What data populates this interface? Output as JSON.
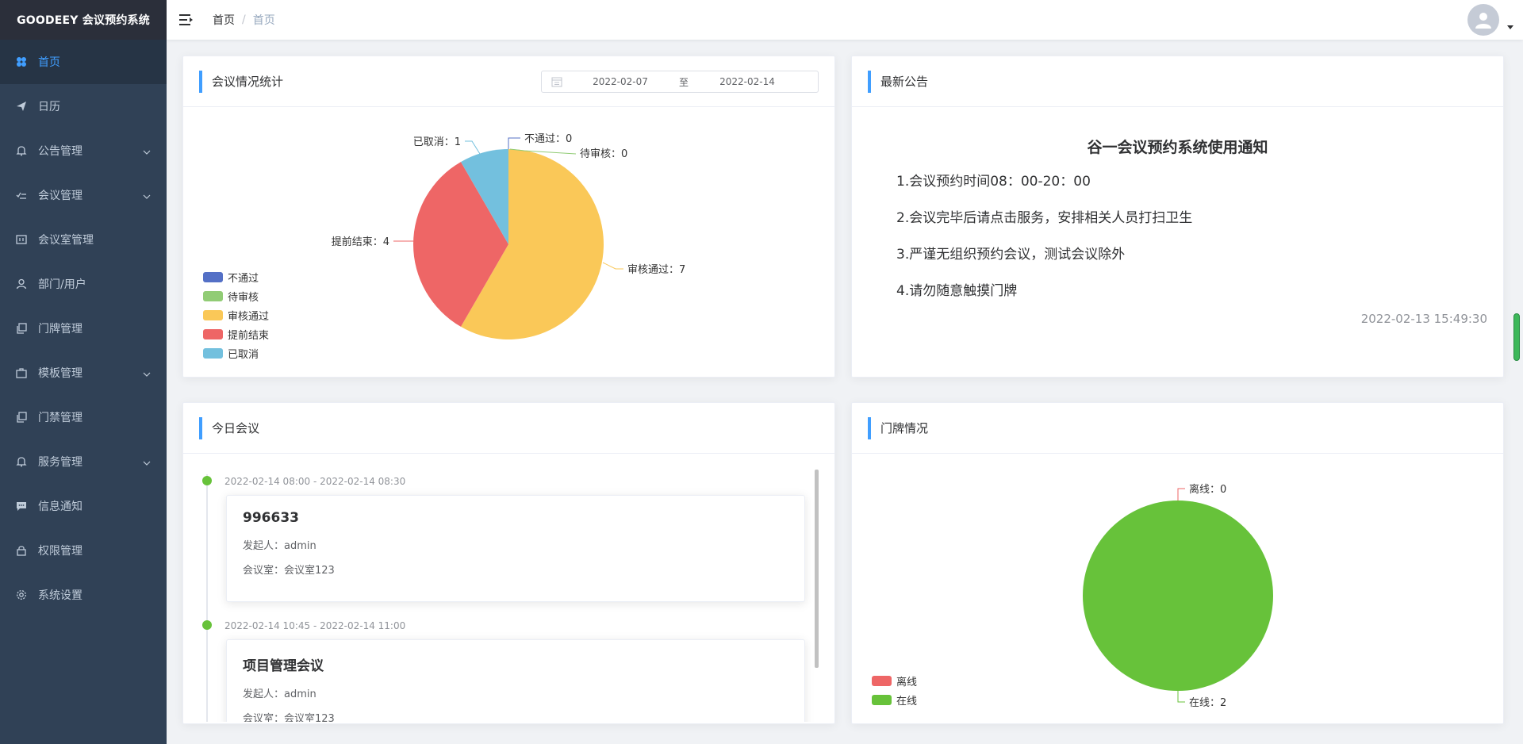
{
  "app": {
    "title": "GOODEEY 会议预约系统"
  },
  "sidebar": {
    "items": [
      {
        "label": "首页",
        "icon": "dashboard-icon",
        "active": true
      },
      {
        "label": "日历",
        "icon": "send-icon"
      },
      {
        "label": "公告管理",
        "icon": "bell-icon",
        "expandable": true
      },
      {
        "label": "会议管理",
        "icon": "check-list-icon",
        "expandable": true
      },
      {
        "label": "会议室管理",
        "icon": "room-icon"
      },
      {
        "label": "部门/用户",
        "icon": "user-icon"
      },
      {
        "label": "门牌管理",
        "icon": "copy-icon"
      },
      {
        "label": "模板管理",
        "icon": "briefcase-icon",
        "expandable": true
      },
      {
        "label": "门禁管理",
        "icon": "copy-icon"
      },
      {
        "label": "服务管理",
        "icon": "bell-icon",
        "expandable": true
      },
      {
        "label": "信息通知",
        "icon": "message-icon"
      },
      {
        "label": "权限管理",
        "icon": "lock-icon"
      },
      {
        "label": "系统设置",
        "icon": "gear-icon"
      }
    ]
  },
  "header": {
    "breadcrumb": [
      "首页",
      "首页"
    ],
    "separator": "/"
  },
  "stats": {
    "title": "会议情况统计",
    "date_start": "2022-02-07",
    "date_sep": "至",
    "date_end": "2022-02-14"
  },
  "notice": {
    "title": "最新公告",
    "heading": "谷一会议预约系统使用通知",
    "lines": [
      "1.会议预约时间08：00-20：00",
      "2.会议完毕后请点击服务，安排相关人员打扫卫生",
      "3.严谨无组织预约会议，测试会议除外",
      "4.请勿随意触摸门牌"
    ],
    "time": "2022-02-13 15:49:30"
  },
  "today": {
    "title": "今日会议",
    "meetings": [
      {
        "time": "2022-02-14 08:00 - 2022-02-14 08:30",
        "name": "996633",
        "initiator": "发起人：admin",
        "room": "会议室：会议室123"
      },
      {
        "time": "2022-02-14 10:45 - 2022-02-14 11:00",
        "name": "项目管理会议",
        "initiator": "发起人：admin",
        "room": "会议室：会议室123"
      }
    ]
  },
  "doorplate": {
    "title": "门牌情况"
  },
  "chart_data": [
    {
      "type": "pie",
      "categories": [
        "不通过",
        "待审核",
        "审核通过",
        "提前结束",
        "已取消"
      ],
      "values": [
        0,
        0,
        7,
        4,
        1
      ],
      "colors": [
        "#5470c6",
        "#91cc75",
        "#fac858",
        "#ee6666",
        "#73c0de"
      ],
      "labels": [
        "不通过：0",
        "待审核：0",
        "审核通过：7",
        "提前结束：4",
        "已取消：1"
      ],
      "legend_position": "bottom-left"
    },
    {
      "type": "pie",
      "categories": [
        "离线",
        "在线"
      ],
      "values": [
        0,
        2
      ],
      "colors": [
        "#ee6666",
        "#67c23a"
      ],
      "labels": [
        "离线：0",
        "在线：2"
      ],
      "legend_position": "bottom-left"
    }
  ]
}
